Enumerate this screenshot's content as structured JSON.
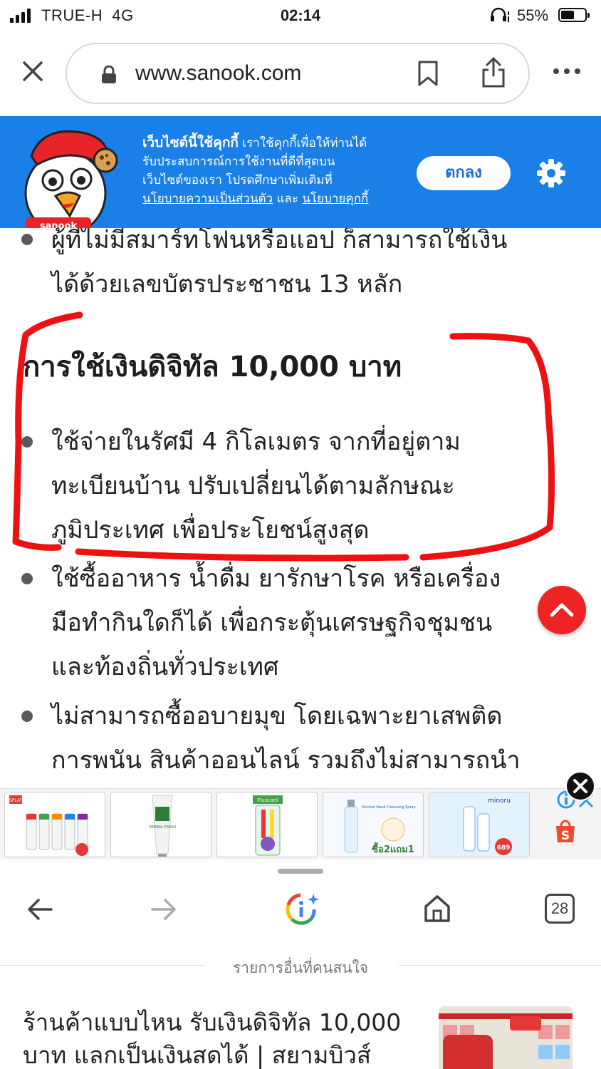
{
  "status_bar": {
    "carrier": "TRUE-H",
    "network": "4G",
    "time": "02:14",
    "battery": "55%",
    "battery_level": 0.55
  },
  "browser": {
    "url": "www.sanook.com"
  },
  "cookie_banner": {
    "title": "เว็บไซต์นี้ใช้คุกกี้",
    "line1": " เราใช้คุกกี้เพื่อให้ท่านได้",
    "line2": "รับประสบการณ์การใช้งานที่ดีที่สุดบน",
    "line3": "เว็บไซต์ของเรา โปรดศึกษาเพิ่มเติมที่",
    "privacy_link": "นโยบายความเป็นส่วนตัว",
    "and": " และ ",
    "cookie_link": "นโยบายคุกกี้",
    "accept_label": "ตกลง",
    "mascot_label": "sanook",
    "brand_color": "#1a7fe6"
  },
  "article": {
    "prev_bullet": [
      "ผู้ที่ไม่มีสมาร์ทโฟนหรือแอป ก็สามารถใช้เงิน",
      "ได้ด้วยเลขบัตรประชาชน 13 หลัก"
    ],
    "heading": "การใช้เงินดิจิทัล 10,000 บาท",
    "bullet1": [
      "ใช้จ่ายในรัศมี 4 กิโลเมตร จากที่อยู่ตาม",
      "ทะเบียนบ้าน ปรับเปลี่ยนได้ตามลักษณะ",
      "ภูมิประเทศ เพื่อประโยชน์สูงสุด"
    ],
    "bullet2": [
      "ใช้ซื้ออาหาร น้ำดื่ม ยารักษาโรค หรือเครื่อง",
      "มือทำกินใดก็ได้ เพื่อกระตุ้นเศรษฐกิจชุมชน",
      "และท้องถิ่นทั่วประเทศ"
    ],
    "bullet3": [
      "ไม่สามารถซื้ออบายมุข โดยเฉพาะยาเสพติด",
      "การพนัน สินค้าออนไลน์ รวมถึงไม่สามารถนำ"
    ],
    "annotation_color": "#ee1111"
  },
  "ads": {
    "items": [
      {
        "label": "SPLAT",
        "alt": "toothpaste-set"
      },
      {
        "label": "HERBAL FRESH",
        "alt": "toothpaste-tube"
      },
      {
        "label": "Fluocaril",
        "alt": "toothbrush-pack"
      },
      {
        "label": "Alcohol Hand Cleansing Spray",
        "badge": "ซื้อ2แถม1"
      },
      {
        "label": "minoru",
        "price": "689"
      }
    ]
  },
  "toolbar": {
    "tab_count": "28"
  },
  "related": {
    "header": "รายการอื่นที่คนสนใจ",
    "title_line1": "ร้านค้าแบบไหน รับเงินดิจิทัล 10,000",
    "title_line2": "บาท แลกเป็นเงินสดได้ | สยามบิวส์"
  }
}
